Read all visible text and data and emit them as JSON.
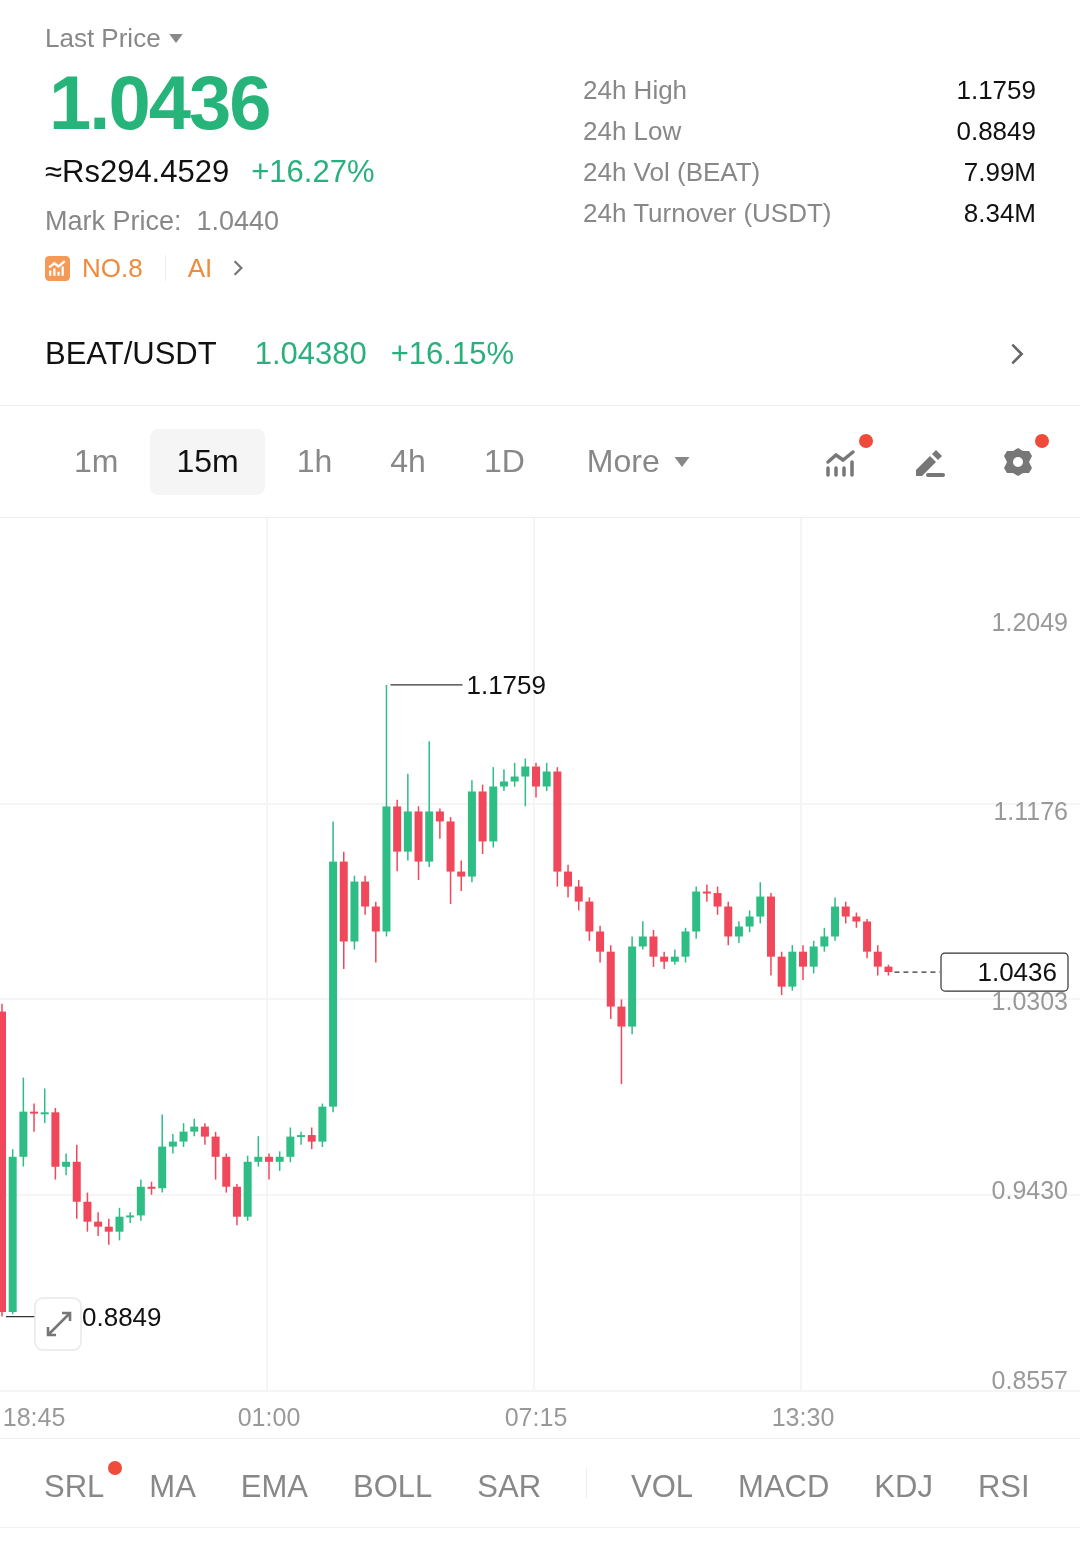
{
  "price_type": {
    "label": "Last Price"
  },
  "last_price": "1.0436",
  "fiat_price": "≈Rs294.4529",
  "change": "+16.27%",
  "mark_price": {
    "label": "Mark Price:",
    "value": "1.0440"
  },
  "rank": {
    "label": "NO.8"
  },
  "ai": {
    "label": "AI"
  },
  "stats": [
    {
      "label": "24h High",
      "value": "1.1759"
    },
    {
      "label": "24h Low",
      "value": "0.8849"
    },
    {
      "label": "24h Vol (BEAT)",
      "value": "7.99M"
    },
    {
      "label": "24h Turnover (USDT)",
      "value": "8.34M"
    }
  ],
  "pair": {
    "symbol": "BEAT/USDT",
    "price": "1.04380",
    "change": "+16.15%"
  },
  "intervals": [
    {
      "label": "1m",
      "selected": false
    },
    {
      "label": "15m",
      "selected": true
    },
    {
      "label": "1h",
      "selected": false
    },
    {
      "label": "4h",
      "selected": false
    },
    {
      "label": "1D",
      "selected": false
    }
  ],
  "more": {
    "label": "More"
  },
  "tools": [
    {
      "kind": "indicators",
      "badge": true
    },
    {
      "kind": "draw",
      "badge": false
    },
    {
      "kind": "settings",
      "badge": true
    }
  ],
  "chart_data": {
    "type": "candlestick",
    "categories": [
      null,
      null,
      null,
      "18:45",
      null,
      null,
      null,
      null,
      null,
      null,
      null,
      null,
      null,
      null,
      null,
      null,
      null,
      null,
      null,
      null,
      null,
      null,
      null,
      null,
      null,
      "01:00",
      null,
      null,
      null,
      null,
      null,
      null,
      null,
      null,
      null,
      null,
      null,
      null,
      null,
      null,
      null,
      null,
      null,
      null,
      null,
      null,
      null,
      null,
      null,
      null,
      "07:15",
      null,
      null,
      null,
      null,
      null,
      null,
      null,
      null,
      null,
      null,
      null,
      null,
      null,
      null,
      null,
      null,
      null,
      null,
      null,
      null,
      null,
      null,
      null,
      null,
      "13:30",
      null,
      null,
      null,
      null,
      null,
      null,
      null,
      null
    ],
    "ohlc": [
      [
        1.0254,
        1.029,
        0.8849,
        0.887
      ],
      [
        0.887,
        0.962,
        0.886,
        0.9585
      ],
      [
        0.9585,
        0.995,
        0.954,
        0.9793
      ],
      [
        0.9793,
        0.983,
        0.97,
        0.9784
      ],
      [
        0.9784,
        0.99,
        0.974,
        0.979
      ],
      [
        0.979,
        0.981,
        0.948,
        0.9539
      ],
      [
        0.9539,
        0.96,
        0.95,
        0.9562
      ],
      [
        0.9562,
        0.964,
        0.93,
        0.9378
      ],
      [
        0.9378,
        0.942,
        0.924,
        0.9286
      ],
      [
        0.9286,
        0.933,
        0.922,
        0.9263
      ],
      [
        0.9263,
        0.93,
        0.918,
        0.924
      ],
      [
        0.924,
        0.935,
        0.92,
        0.9309
      ],
      [
        0.9309,
        0.933,
        0.928,
        0.9315
      ],
      [
        0.9315,
        0.948,
        0.929,
        0.9447
      ],
      [
        0.9447,
        0.947,
        0.941,
        0.944
      ],
      [
        0.944,
        0.978,
        0.942,
        0.9632
      ],
      [
        0.9632,
        0.969,
        0.96,
        0.9655
      ],
      [
        0.9655,
        0.974,
        0.963,
        0.9701
      ],
      [
        0.9701,
        0.976,
        0.968,
        0.9724
      ],
      [
        0.9724,
        0.974,
        0.964,
        0.9678
      ],
      [
        0.9678,
        0.97,
        0.948,
        0.9585
      ],
      [
        0.9585,
        0.96,
        0.942,
        0.9447
      ],
      [
        0.9447,
        0.946,
        0.927,
        0.9309
      ],
      [
        0.9309,
        0.959,
        0.929,
        0.9562
      ],
      [
        0.9562,
        0.968,
        0.954,
        0.9585
      ],
      [
        0.9585,
        0.96,
        0.948,
        0.9562
      ],
      [
        0.9562,
        0.961,
        0.952,
        0.9585
      ],
      [
        0.9585,
        0.972,
        0.956,
        0.9678
      ],
      [
        0.9678,
        0.97,
        0.964,
        0.9685
      ],
      [
        0.9685,
        0.972,
        0.962,
        0.9655
      ],
      [
        0.9655,
        0.983,
        0.963,
        0.9816
      ],
      [
        0.9816,
        1.113,
        0.979,
        1.0945
      ],
      [
        1.0945,
        1.099,
        1.045,
        1.0577
      ],
      [
        1.0577,
        1.088,
        1.054,
        1.0853
      ],
      [
        1.0853,
        1.088,
        1.07,
        1.0738
      ],
      [
        1.0738,
        1.076,
        1.048,
        1.0623
      ],
      [
        1.0623,
        1.1759,
        1.06,
        1.1199
      ],
      [
        1.1199,
        1.123,
        1.09,
        1.0991
      ],
      [
        1.0991,
        1.135,
        1.095,
        1.1176
      ],
      [
        1.1176,
        1.12,
        1.086,
        1.0945
      ],
      [
        1.0945,
        1.15,
        1.092,
        1.1176
      ],
      [
        1.1176,
        1.119,
        1.105,
        1.113
      ],
      [
        1.113,
        1.115,
        1.075,
        1.0899
      ],
      [
        1.0899,
        1.095,
        1.081,
        1.0876
      ],
      [
        1.0876,
        1.132,
        1.085,
        1.1268
      ],
      [
        1.1268,
        1.13,
        1.098,
        1.1038
      ],
      [
        1.1038,
        1.138,
        1.101,
        1.1291
      ],
      [
        1.1291,
        1.137,
        1.127,
        1.1314
      ],
      [
        1.1314,
        1.14,
        1.129,
        1.1337
      ],
      [
        1.1337,
        1.142,
        1.12,
        1.1383
      ],
      [
        1.1383,
        1.14,
        1.124,
        1.1291
      ],
      [
        1.1291,
        1.14,
        1.127,
        1.136
      ],
      [
        1.136,
        1.138,
        1.083,
        1.0899
      ],
      [
        1.0899,
        1.093,
        1.078,
        1.083
      ],
      [
        1.083,
        1.086,
        1.072,
        1.0761
      ],
      [
        1.0761,
        1.078,
        1.058,
        1.0623
      ],
      [
        1.0623,
        1.065,
        1.048,
        1.053
      ],
      [
        1.053,
        1.056,
        1.022,
        1.0277
      ],
      [
        1.0277,
        1.031,
        0.992,
        1.0185
      ],
      [
        1.0185,
        1.06,
        1.015,
        1.0554
      ],
      [
        1.0554,
        1.067,
        1.054,
        1.06
      ],
      [
        1.06,
        1.063,
        1.046,
        1.0507
      ],
      [
        1.0507,
        1.053,
        1.045,
        1.0484
      ],
      [
        1.0484,
        1.054,
        1.047,
        1.0507
      ],
      [
        1.0507,
        1.064,
        1.048,
        1.0623
      ],
      [
        1.0623,
        1.083,
        1.059,
        1.0807
      ],
      [
        1.0807,
        1.084,
        1.076,
        1.08
      ],
      [
        1.08,
        1.083,
        1.07,
        1.0738
      ],
      [
        1.0738,
        1.076,
        1.056,
        1.06
      ],
      [
        1.06,
        1.067,
        1.057,
        1.0646
      ],
      [
        1.0646,
        1.072,
        1.062,
        1.0692
      ],
      [
        1.0692,
        1.085,
        1.066,
        1.0784
      ],
      [
        1.0784,
        1.08,
        1.042,
        1.0507
      ],
      [
        1.0507,
        1.053,
        1.033,
        1.0369
      ],
      [
        1.0369,
        1.056,
        1.035,
        1.053
      ],
      [
        1.053,
        1.056,
        1.04,
        1.0461
      ],
      [
        1.0461,
        1.058,
        1.043,
        1.0554
      ],
      [
        1.0554,
        1.064,
        1.053,
        1.06
      ],
      [
        1.06,
        1.078,
        1.058,
        1.0738
      ],
      [
        1.0738,
        1.076,
        1.066,
        1.0692
      ],
      [
        1.0692,
        1.071,
        1.064,
        1.0669
      ],
      [
        1.0669,
        1.068,
        1.05,
        1.053
      ],
      [
        1.053,
        1.056,
        1.042,
        1.0461
      ],
      [
        1.0461,
        1.047,
        1.042,
        1.0436
      ]
    ],
    "ylim": [
      0.8506,
      1.2528
    ],
    "yticks": [
      {
        "value": 1.2049,
        "label": "1.2049"
      },
      {
        "value": 1.1176,
        "label": "1.1176"
      },
      {
        "value": 1.0303,
        "label": "1.0303"
      },
      {
        "value": 0.943,
        "label": "0.9430"
      },
      {
        "value": 0.8557,
        "label": "0.8557"
      }
    ],
    "annotations": [
      "1.1759",
      "0.8849",
      "1.0436"
    ],
    "grid": true
  },
  "main_indicators": [
    {
      "label": "SRL",
      "badge": true
    },
    {
      "label": "MA",
      "badge": false
    },
    {
      "label": "EMA",
      "badge": false
    },
    {
      "label": "BOLL",
      "badge": false
    },
    {
      "label": "SAR",
      "badge": false
    }
  ],
  "sub_indicators": [
    {
      "label": "VOL",
      "badge": false
    },
    {
      "label": "MACD",
      "badge": false
    },
    {
      "label": "KDJ",
      "badge": false
    },
    {
      "label": "RSI",
      "badge": false
    }
  ]
}
